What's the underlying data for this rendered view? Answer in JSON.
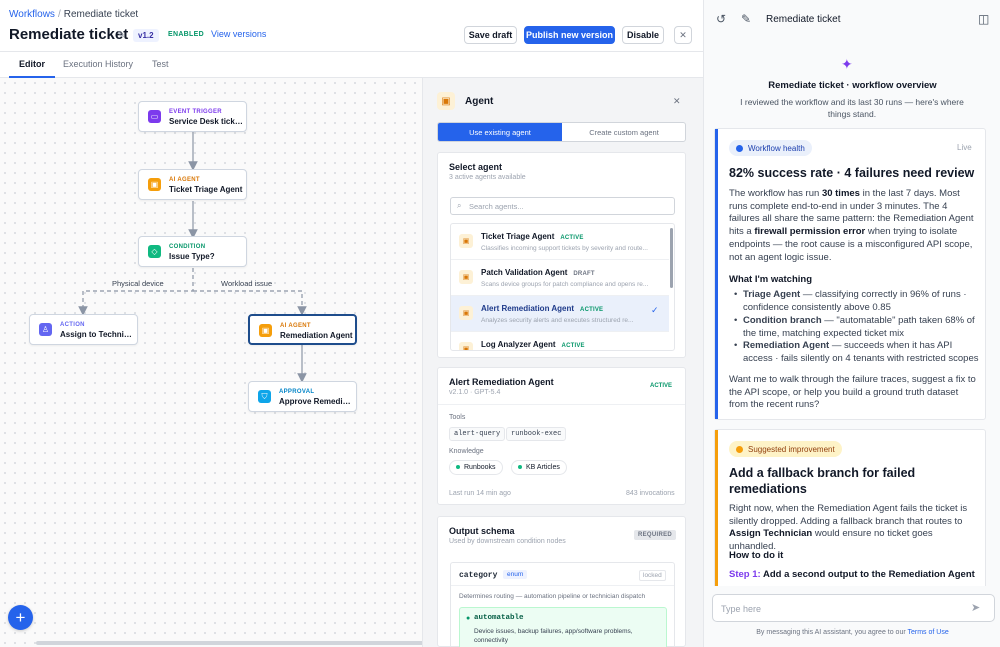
{
  "breadcrumb": {
    "parent": "Workflows",
    "separator": "/",
    "current": "Remediate ticket"
  },
  "header": {
    "title": "Remediate ticket",
    "version": "v1.2",
    "status": "ENABLED",
    "view_versions": "View versions",
    "buttons": {
      "save_draft": "Save draft",
      "publish": "Publish new version",
      "disable": "Disable",
      "close": "✕"
    }
  },
  "tabs": [
    {
      "label": "Editor",
      "active": true
    },
    {
      "label": "Execution History",
      "active": false
    },
    {
      "label": "Test",
      "active": false
    }
  ],
  "nodes": {
    "trigger": {
      "kind": "EVENT TRIGGER",
      "label": "Service Desk ticket created",
      "icon": "bolt-icon"
    },
    "triage": {
      "kind": "AI AGENT",
      "label": "Ticket Triage Agent",
      "icon": "robot-icon"
    },
    "condition": {
      "kind": "CONDITION",
      "label": "Issue Type?",
      "icon": "diamond-icon"
    },
    "assign": {
      "kind": "ACTION",
      "label": "Assign to Technician",
      "icon": "user-assign-icon"
    },
    "remediation": {
      "kind": "AI AGENT",
      "label": "Remediation Agent",
      "icon": "robot-icon"
    },
    "approval": {
      "kind": "APPROVAL",
      "label": "Approve Remediation",
      "icon": "shield-check-icon"
    }
  },
  "edge_labels": {
    "left": "Physical device",
    "right": "Workload issue"
  },
  "panel": {
    "title": "Agent",
    "close": "✕",
    "segments": {
      "existing": "Use existing agent",
      "custom": "Create custom agent"
    },
    "select": {
      "heading": "Select agent",
      "sub": "3 active agents available",
      "search_placeholder": "Search agents...",
      "agents": [
        {
          "name": "Ticket Triage Agent",
          "badge": "ACTIVE",
          "desc": "Classifies incoming support tickets by severity and route..."
        },
        {
          "name": "Patch Validation Agent",
          "badge": "DRAFT",
          "desc": "Scans device groups for patch compliance and opens re..."
        },
        {
          "name": "Alert Remediation Agent",
          "badge": "ACTIVE",
          "desc": "Analyzes security alerts and executes structured re..."
        },
        {
          "name": "Log Analyzer Agent",
          "badge": "ACTIVE",
          "desc": ""
        }
      ]
    },
    "detail": {
      "name": "Alert Remediation Agent",
      "meta": "v2.1.0 · GPT-5.4",
      "badge": "ACTIVE",
      "tools_label": "Tools",
      "tools": [
        "alert-query",
        "runbook-exec"
      ],
      "knowledge_label": "Knowledge",
      "knowledge": [
        "Runbooks",
        "KB Articles"
      ],
      "last_run": "Last run 14 min ago",
      "invocations": "843 invocations"
    },
    "schema": {
      "heading": "Output schema",
      "sub": "Used by downstream condition nodes",
      "required": "REQUIRED",
      "field": "category",
      "type": "enum",
      "locked": "locked",
      "field_desc": "Determines routing — automation pipeline or technician dispatch",
      "option_name": "automatable",
      "option_desc": "Device issues, backup failures, app/software problems, connectivity"
    }
  },
  "assistant": {
    "title": "Remediate ticket",
    "overview_title": "Remediate ticket · workflow overview",
    "overview_sub": "I reviewed the workflow and its last 30 runs — here's where things stand.",
    "health": {
      "chip": "Workflow health",
      "live": "Live",
      "headline": "82% success rate · 4 failures need review",
      "p1_a": "The workflow has run ",
      "p1_b": "30 times",
      "p1_c": " in the last 7 days. Most runs complete end-to-end in under 3 minutes. The 4 failures all share the same pattern: the Remediation Agent hits a ",
      "p1_d": "firewall permission error",
      "p1_e": " when trying to isolate endpoints — the root cause is a misconfigured API scope, not an agent logic issue.",
      "watch_heading": "What I'm watching",
      "bullets": [
        {
          "bold": "Triage Agent",
          "text": " — classifying correctly in 96% of runs · confidence consistently above 0.85"
        },
        {
          "bold": "Condition branch",
          "text": " — \"automatable\" path taken 68% of the time, matching expected ticket mix"
        },
        {
          "bold": "Remediation Agent",
          "text": " — succeeds when it has API access · fails silently on 4 tenants with restricted scopes"
        }
      ],
      "closing": "Want me to walk through the failure traces, suggest a fix to the API scope, or help you build a ground truth dataset from the recent runs?"
    },
    "suggestion": {
      "chip": "Suggested improvement",
      "headline": "Add a fallback branch for failed remediations",
      "p_a": "Right now, when the Remediation Agent fails the ticket is silently dropped. Adding a fallback branch that routes to ",
      "p_b": "Assign Technician",
      "p_c": " would ensure no ticket goes unhandled.",
      "how": "How to do it",
      "step_label": "Step 1:",
      "step_text": " Add a second output to the Remediation Agent"
    },
    "input_placeholder": "Type here",
    "disclaimer": "By messaging this AI assistant, you agree to our ",
    "terms": "Terms of Use"
  },
  "colors": {
    "accent": "#2563eb",
    "agent": "#f59e0b",
    "trigger": "#7c3aed",
    "condition": "#10b981",
    "action": "#6366f1",
    "approval": "#0ea5e9",
    "suggestion": "#f59e0b"
  }
}
